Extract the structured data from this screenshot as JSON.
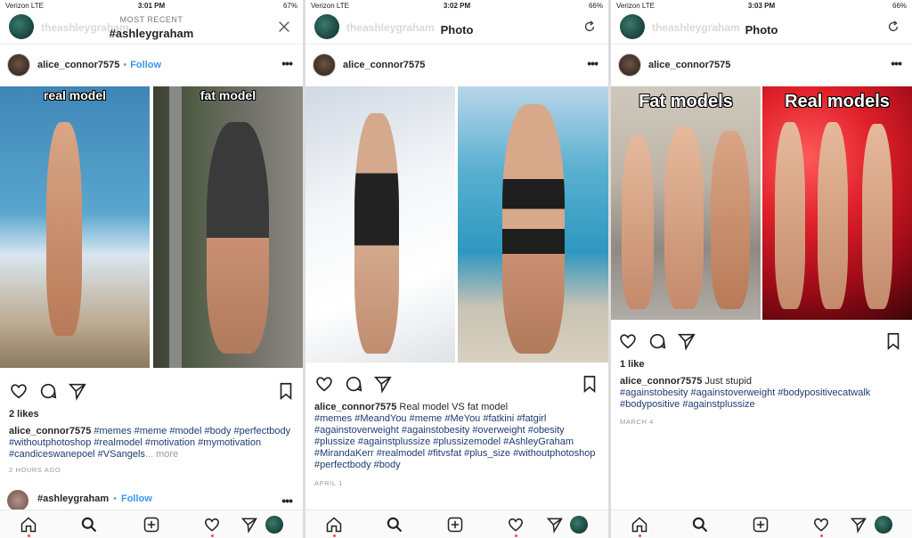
{
  "panels": [
    {
      "status": {
        "carrier": "Verizon  LTE",
        "time": "3:01 PM",
        "battery": "67%"
      },
      "topnav": {
        "ghost_user": "theashleygraham",
        "subtitle": "MOST RECENT",
        "title": "#ashleygraham",
        "right_icon": "close-icon"
      },
      "post": {
        "username": "alice_connor7575",
        "dot": "•",
        "follow": "Follow",
        "more": "•••"
      },
      "photo": {
        "left_caption": "real model",
        "right_caption": "fat model"
      },
      "likes": "2 likes",
      "caption": {
        "user": "alice_connor7575",
        "text": "",
        "tags": "#memes #meme #model #body #perfectbody #withoutphotoshop #realmodel #motivation #mymotivation #candiceswanepoel #VSangels",
        "more": "... more"
      },
      "timestamp": "2 HOURS AGO",
      "next_post": {
        "username": "#ashleygraham",
        "dot": "•",
        "follow": "Follow",
        "more": "•••"
      }
    },
    {
      "status": {
        "carrier": "Verizon  LTE",
        "time": "3:02 PM",
        "battery": "66%"
      },
      "topnav": {
        "ghost_user": "theashleygraham",
        "title": "Photo",
        "right_icon": "refresh-icon"
      },
      "post": {
        "username": "alice_connor7575",
        "more": "•••"
      },
      "likes": "",
      "caption": {
        "user": "alice_connor7575",
        "text": " Real model VS fat model",
        "tags": "#memes #MeandYou #meme #MeYou #fatkini #fatgirl #againstoverweight #againstobesity #overweight #obesity #plussize #againstplussize #plussizemodel #AshleyGraham #MirandaKerr #realmodel #fitvsfat #plus_size #withoutphotoshop #perfectbody #body"
      },
      "timestamp": "APRIL 1"
    },
    {
      "status": {
        "carrier": "Verizon  LTE",
        "time": "3:03 PM",
        "battery": "66%"
      },
      "topnav": {
        "ghost_user": "theashleygraham",
        "title": "Photo",
        "right_icon": "refresh-icon"
      },
      "post": {
        "username": "alice_connor7575",
        "more": "•••"
      },
      "photo": {
        "left_caption": "Fat models",
        "right_caption": "Real models"
      },
      "likes": "1 like",
      "caption": {
        "user": "alice_connor7575",
        "text": " Just stupid",
        "tags": "#againstobesity #againstoverweight #bodypositivecatwalk #bodypositive #againstplussize"
      },
      "timestamp": "MARCH 4"
    }
  ],
  "bottom_nav": [
    "home-icon",
    "search-icon",
    "add-icon",
    "heart-icon",
    "direct-icon",
    "profile-avatar"
  ],
  "colors": {
    "link": "#3897f0",
    "hashtag": "#1d3b72",
    "notification": "#ed4956"
  }
}
